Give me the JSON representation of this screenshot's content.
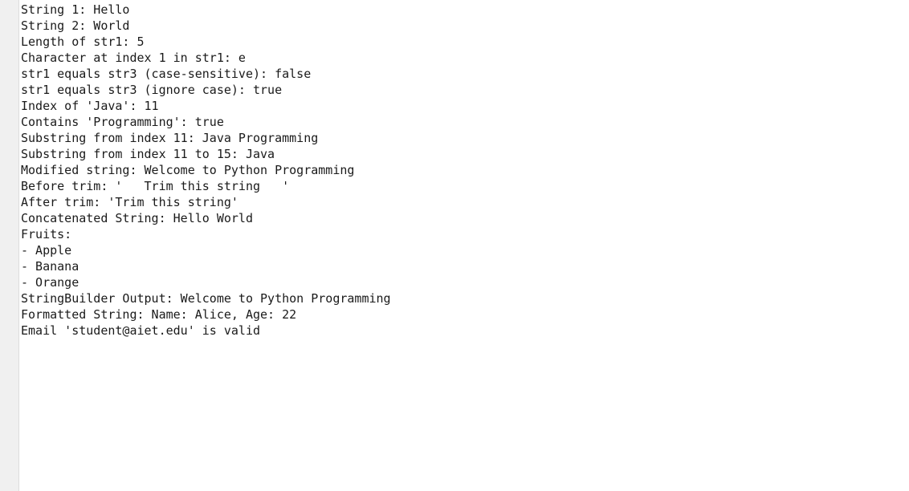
{
  "console": {
    "lines": [
      "String 1: Hello",
      "String 2: World",
      "Length of str1: 5",
      "Character at index 1 in str1: e",
      "str1 equals str3 (case-sensitive): false",
      "str1 equals str3 (ignore case): true",
      "Index of 'Java': 11",
      "Contains 'Programming': true",
      "Substring from index 11: Java Programming",
      "Substring from index 11 to 15: Java",
      "Modified string: Welcome to Python Programming",
      "Before trim: '   Trim this string   '",
      "After trim: 'Trim this string'",
      "Concatenated String: Hello World",
      "Fruits:",
      "- Apple",
      "- Banana",
      "- Orange",
      "StringBuilder Output: Welcome to Python Programming",
      "Formatted String: Name: Alice, Age: 22",
      "Email 'student@aiet.edu' is valid"
    ]
  },
  "colors": {
    "background": "#ffffff",
    "gutter": "#f0f0f0",
    "text": "#1a1a1a"
  }
}
